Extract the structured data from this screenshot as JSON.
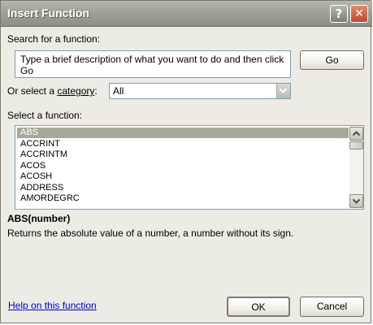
{
  "window": {
    "title": "Insert Function",
    "help_glyph": "?",
    "close_glyph": "✕"
  },
  "search": {
    "label": "Search for a function:",
    "value": "Type a brief description of what you want to do and then click Go",
    "go_button": "Go"
  },
  "category": {
    "label_prefix": "Or select a ",
    "label_key": "category",
    "label_suffix": ":",
    "selected": "All"
  },
  "functions": {
    "label": "Select a function:",
    "items": [
      "ABS",
      "ACCRINT",
      "ACCRINTM",
      "ACOS",
      "ACOSH",
      "ADDRESS",
      "AMORDEGRC"
    ],
    "selected_index": 0
  },
  "details": {
    "syntax": "ABS(number)",
    "description": "Returns the absolute value of a number, a number without its sign."
  },
  "footer": {
    "help_link": "Help on this function",
    "ok_button": "OK",
    "cancel_button": "Cancel"
  },
  "icons": {
    "scroll_up": "chevron-up-icon",
    "scroll_down": "chevron-down-icon",
    "dropdown": "chevron-down-icon"
  },
  "colors": {
    "titlebar": "#a2a198",
    "dialog_bg": "#ecebe4",
    "selection": "#a8a79c",
    "close_button": "#c0482a",
    "link": "#0000cc",
    "input_border": "#7f9db9"
  }
}
